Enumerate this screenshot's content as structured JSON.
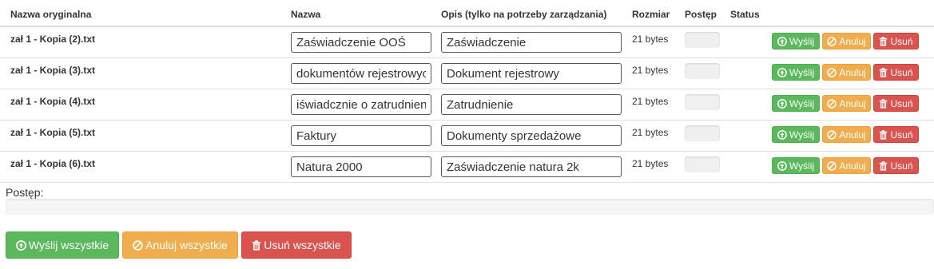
{
  "headers": {
    "original": "Nazwa oryginalna",
    "name": "Nazwa",
    "description": "Opis (tylko na potrzeby zarządzania)",
    "size": "Rozmiar",
    "progress": "Postęp",
    "status": "Status"
  },
  "rows": [
    {
      "original": "zał 1 - Kopia (2).txt",
      "name": "Zaświadczenie OOŚ",
      "description": "Zaświadczenie",
      "size": "21 bytes",
      "progress": 0
    },
    {
      "original": "zał 1 - Kopia (3).txt",
      "name": "dokumentów rejestrowych",
      "description": "Dokument rejestrowy",
      "size": "21 bytes",
      "progress": 0
    },
    {
      "original": "zał 1 - Kopia (4).txt",
      "name": "iświadcznie o zatrudnieniu",
      "description": "Zatrudnienie",
      "size": "21 bytes",
      "progress": 0
    },
    {
      "original": "zał 1 - Kopia (5).txt",
      "name": "Faktury",
      "description": "Dokumenty sprzedażowe",
      "size": "21 bytes",
      "progress": 0
    },
    {
      "original": "zał 1 - Kopia (6).txt",
      "name": "Natura 2000",
      "description": "Zaświadczenie natura 2k",
      "size": "21 bytes",
      "progress": 0
    }
  ],
  "row_buttons": {
    "send": "Wyślij",
    "cancel": "Anuluj",
    "delete": "Usuń"
  },
  "overall": {
    "label": "Postęp:",
    "progress": 0
  },
  "bulk_buttons": {
    "send_all": "Wyślij wszystkie",
    "cancel_all": "Anuluj wszystkie",
    "delete_all": "Usuń wszystkie"
  },
  "icons": {
    "send": "circle-arrow-up-icon",
    "cancel": "ban-circle-icon",
    "delete": "trash-icon"
  },
  "colors": {
    "success": "#5cb85c",
    "warning": "#f0ad4e",
    "danger": "#d9534f"
  }
}
